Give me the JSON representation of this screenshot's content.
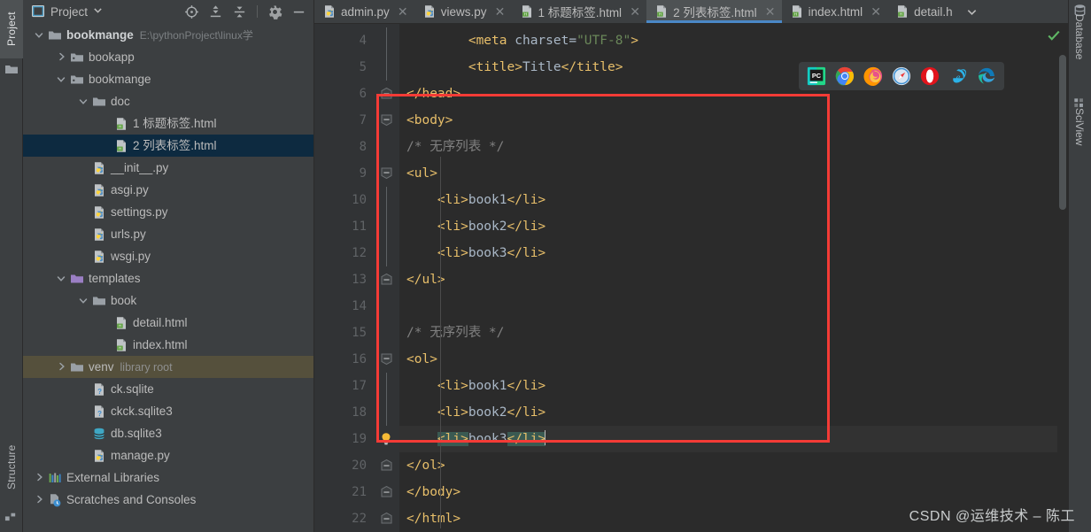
{
  "left_strip": {
    "tabs": [
      {
        "id": "project",
        "label": "Project",
        "active": true
      },
      {
        "id": "structure",
        "label": "Structure",
        "active": false
      }
    ]
  },
  "project_panel": {
    "title": "Project",
    "toolbar": [
      {
        "name": "locate-icon",
        "tooltip": "Select Opened File"
      },
      {
        "name": "expand-all-icon",
        "tooltip": "Expand All"
      },
      {
        "name": "collapse-all-icon",
        "tooltip": "Collapse All"
      },
      {
        "name": "gear-icon",
        "tooltip": "Settings"
      },
      {
        "name": "minimize-icon",
        "tooltip": "Hide"
      }
    ],
    "tree": [
      {
        "label": "bookmange",
        "path": "E:\\pythonProject\\linux学",
        "indent": 0,
        "icon": "folder",
        "arrow": "down",
        "bold": true
      },
      {
        "label": "bookapp",
        "indent": 1,
        "icon": "module-folder",
        "arrow": "right"
      },
      {
        "label": "bookmange",
        "indent": 1,
        "icon": "module-folder",
        "arrow": "down"
      },
      {
        "label": "doc",
        "indent": 2,
        "icon": "folder",
        "arrow": "down"
      },
      {
        "label": "1 标题标签.html",
        "indent": 3,
        "icon": "html"
      },
      {
        "label": "2 列表标签.html",
        "indent": 3,
        "icon": "html",
        "selected": true
      },
      {
        "label": "__init__.py",
        "indent": 2,
        "icon": "python"
      },
      {
        "label": "asgi.py",
        "indent": 2,
        "icon": "python"
      },
      {
        "label": "settings.py",
        "indent": 2,
        "icon": "python"
      },
      {
        "label": "urls.py",
        "indent": 2,
        "icon": "python"
      },
      {
        "label": "wsgi.py",
        "indent": 2,
        "icon": "python"
      },
      {
        "label": "templates",
        "indent": 1,
        "icon": "templates-folder",
        "arrow": "down"
      },
      {
        "label": "book",
        "indent": 2,
        "icon": "folder",
        "arrow": "down"
      },
      {
        "label": "detail.html",
        "indent": 3,
        "icon": "html"
      },
      {
        "label": "index.html",
        "indent": 3,
        "icon": "html"
      },
      {
        "label": "venv",
        "sublabel": "library root",
        "indent": 1,
        "icon": "folder",
        "arrow": "right",
        "venv": true
      },
      {
        "label": "ck.sqlite",
        "indent": 2,
        "icon": "unknown-file"
      },
      {
        "label": "ckck.sqlite3",
        "indent": 2,
        "icon": "unknown-file"
      },
      {
        "label": "db.sqlite3",
        "indent": 2,
        "icon": "database-file"
      },
      {
        "label": "manage.py",
        "indent": 2,
        "icon": "python"
      },
      {
        "label": "External Libraries",
        "indent": 0,
        "icon": "libraries",
        "arrow": "right"
      },
      {
        "label": "Scratches and Consoles",
        "indent": 0,
        "icon": "scratches",
        "arrow": "right"
      }
    ]
  },
  "editor": {
    "tabs": [
      {
        "label": "admin.py",
        "icon": "python",
        "active": false,
        "closable": true
      },
      {
        "label": "views.py",
        "icon": "python",
        "active": false,
        "closable": true
      },
      {
        "label": "1 标题标签.html",
        "icon": "html",
        "active": false,
        "closable": true
      },
      {
        "label": "2 列表标签.html",
        "icon": "html",
        "active": true,
        "closable": true
      },
      {
        "label": "index.html",
        "icon": "html",
        "active": false,
        "closable": true
      },
      {
        "label": "detail.h",
        "icon": "html",
        "active": false,
        "closable": false
      }
    ],
    "close_glyph": "✕",
    "chevron_glyph": "⌄",
    "lines": [
      {
        "n": "4",
        "fold": "line",
        "segments": [
          {
            "t": "        ",
            "c": "txt"
          },
          {
            "t": "<meta ",
            "c": "tag"
          },
          {
            "t": "charset=",
            "c": "attr"
          },
          {
            "t": "\"UTF-8\"",
            "c": "aval"
          },
          {
            "t": ">",
            "c": "tag"
          }
        ]
      },
      {
        "n": "5",
        "fold": "line",
        "segments": [
          {
            "t": "        ",
            "c": "txt"
          },
          {
            "t": "<title>",
            "c": "tag"
          },
          {
            "t": "Title",
            "c": "txt"
          },
          {
            "t": "</title>",
            "c": "tag"
          }
        ]
      },
      {
        "n": "6",
        "fold": "end",
        "segments": [
          {
            "t": "</head>",
            "c": "tag"
          }
        ]
      },
      {
        "n": "7",
        "fold": "start",
        "segments": [
          {
            "t": "<body>",
            "c": "tag"
          }
        ]
      },
      {
        "n": "8",
        "fold": "none",
        "segments": [
          {
            "t": "/* 无序列表 */",
            "c": "cmt"
          }
        ]
      },
      {
        "n": "9",
        "fold": "start",
        "segments": [
          {
            "t": "<ul>",
            "c": "tag"
          }
        ]
      },
      {
        "n": "10",
        "fold": "line",
        "segments": [
          {
            "t": "    ",
            "c": "txt"
          },
          {
            "t": "<li>",
            "c": "tag"
          },
          {
            "t": "book1",
            "c": "txt"
          },
          {
            "t": "</li>",
            "c": "tag"
          }
        ]
      },
      {
        "n": "11",
        "fold": "line",
        "segments": [
          {
            "t": "    ",
            "c": "txt"
          },
          {
            "t": "<li>",
            "c": "tag"
          },
          {
            "t": "book2",
            "c": "txt"
          },
          {
            "t": "</li>",
            "c": "tag"
          }
        ]
      },
      {
        "n": "12",
        "fold": "line",
        "segments": [
          {
            "t": "    ",
            "c": "txt"
          },
          {
            "t": "<li>",
            "c": "tag"
          },
          {
            "t": "book3",
            "c": "txt"
          },
          {
            "t": "</li>",
            "c": "tag"
          }
        ]
      },
      {
        "n": "13",
        "fold": "end",
        "segments": [
          {
            "t": "</ul>",
            "c": "tag"
          }
        ]
      },
      {
        "n": "14",
        "fold": "none",
        "segments": []
      },
      {
        "n": "15",
        "fold": "none",
        "segments": [
          {
            "t": "/* 无序列表 */",
            "c": "cmt"
          }
        ]
      },
      {
        "n": "16",
        "fold": "start",
        "segments": [
          {
            "t": "<ol>",
            "c": "tag"
          }
        ]
      },
      {
        "n": "17",
        "fold": "line",
        "segments": [
          {
            "t": "    ",
            "c": "txt"
          },
          {
            "t": "<li>",
            "c": "tag"
          },
          {
            "t": "book1",
            "c": "txt"
          },
          {
            "t": "</li>",
            "c": "tag"
          }
        ]
      },
      {
        "n": "18",
        "fold": "line",
        "segments": [
          {
            "t": "    ",
            "c": "txt"
          },
          {
            "t": "<li>",
            "c": "tag"
          },
          {
            "t": "book2",
            "c": "txt"
          },
          {
            "t": "</li>",
            "c": "tag"
          }
        ]
      },
      {
        "n": "19",
        "fold": "bulb",
        "current": true,
        "caret": true,
        "segments": [
          {
            "t": "    ",
            "c": "txt"
          },
          {
            "t": "<li>",
            "c": "tag",
            "hl": true
          },
          {
            "t": "book3",
            "c": "txt"
          },
          {
            "t": "</li>",
            "c": "tag",
            "hl": true
          }
        ]
      },
      {
        "n": "20",
        "fold": "end",
        "segments": [
          {
            "t": "</ol>",
            "c": "tag"
          }
        ]
      },
      {
        "n": "21",
        "fold": "end",
        "segments": [
          {
            "t": "</body>",
            "c": "tag"
          }
        ]
      },
      {
        "n": "22",
        "fold": "end",
        "segments": [
          {
            "t": "</html>",
            "c": "tag"
          }
        ]
      }
    ],
    "browser_bar": [
      {
        "name": "pycharm-preview-icon",
        "label": "PyCharm"
      },
      {
        "name": "chrome-icon",
        "label": "Chrome"
      },
      {
        "name": "firefox-icon",
        "label": "Firefox"
      },
      {
        "name": "safari-icon",
        "label": "Safari"
      },
      {
        "name": "opera-icon",
        "label": "Opera"
      },
      {
        "name": "internet-explorer-icon",
        "label": "Internet Explorer"
      },
      {
        "name": "edge-icon",
        "label": "Edge"
      }
    ],
    "inspection_status": "ok",
    "annotation": {
      "name": "red-highlight-rectangle",
      "color": "#f43b36"
    }
  },
  "right_strip": {
    "tabs": [
      {
        "id": "database",
        "label": "Database"
      },
      {
        "id": "sciview",
        "label": "SciView"
      }
    ]
  },
  "watermark": {
    "text": "CSDN @运维技术 – 陈工"
  },
  "colors": {
    "panel_bg": "#3c3f41",
    "editor_bg": "#2b2b2b",
    "gutter_bg": "#313335",
    "selection_blue": "#0d2a40",
    "venv_olive": "#55503c",
    "tab_active": "#4e5254",
    "tab_underline": "#4a88c7",
    "tag_orange": "#e8bf6a",
    "text_gray": "#a9b7c6",
    "comment_gray": "#808080",
    "attr_green": "#6a8759",
    "match_teal": "#3a5a52",
    "annotation_red": "#f43b36"
  }
}
